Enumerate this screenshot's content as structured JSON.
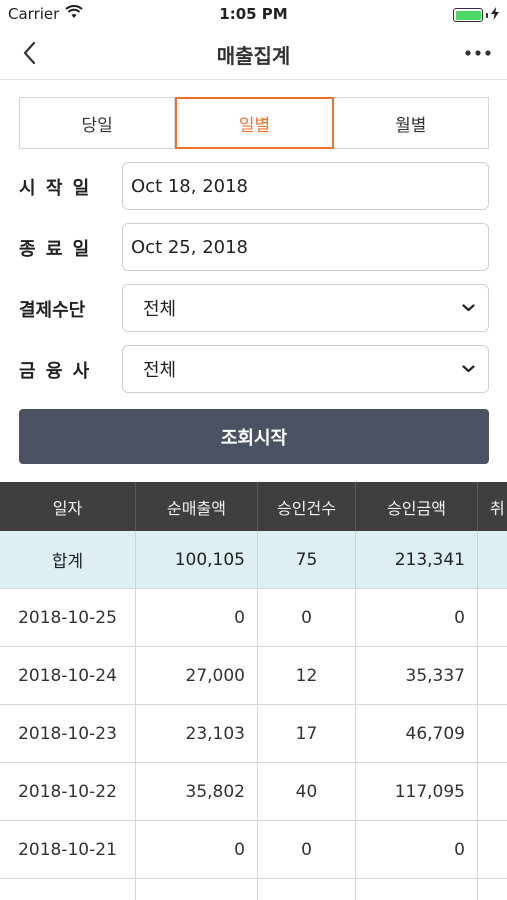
{
  "status_bar": {
    "carrier": "Carrier",
    "time": "1:05 PM"
  },
  "nav": {
    "title": "매출집계",
    "back_icon": "chevron-left-icon",
    "more_icon": "more-horizontal-icon"
  },
  "segments": [
    {
      "label": "당일",
      "active": false
    },
    {
      "label": "일별",
      "active": true
    },
    {
      "label": "월별",
      "active": false
    }
  ],
  "form": {
    "start_label": "시 작 일",
    "start_value": "Oct 18, 2018",
    "end_label": "종 료 일",
    "end_value": "Oct 25, 2018",
    "payment_label": "결제수단",
    "payment_value": "전체",
    "company_label": "금 융 사",
    "company_value": "전체"
  },
  "search_button": "조회시작",
  "colors": {
    "accent": "#f2702d",
    "button_bg": "#4b5261",
    "table_header_bg": "#3f3f3f",
    "total_row_bg": "#ddeff2"
  },
  "table": {
    "headers": [
      "일자",
      "순매출액",
      "승인건수",
      "승인금액",
      "취"
    ],
    "total": [
      "합계",
      "100,105",
      "75",
      "213,341",
      ""
    ],
    "rows": [
      [
        "2018-10-25",
        "0",
        "0",
        "0",
        ""
      ],
      [
        "2018-10-24",
        "27,000",
        "12",
        "35,337",
        ""
      ],
      [
        "2018-10-23",
        "23,103",
        "17",
        "46,709",
        ""
      ],
      [
        "2018-10-22",
        "35,802",
        "40",
        "117,095",
        ""
      ],
      [
        "2018-10-21",
        "0",
        "0",
        "0",
        ""
      ],
      [
        "",
        "",
        "",
        "",
        ""
      ]
    ]
  }
}
